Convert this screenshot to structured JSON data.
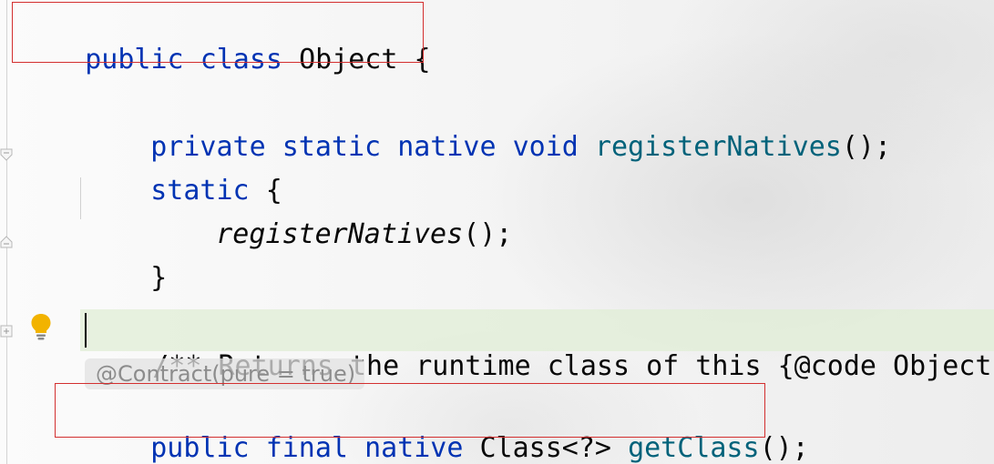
{
  "code": {
    "line_class_decl": {
      "kw1": "public",
      "kw2": "class",
      "name": "Object",
      "brace": "{"
    },
    "line_register": {
      "kw1": "private",
      "kw2": "static",
      "kw3": "native",
      "kw4": "void",
      "fn": "registerNatives",
      "tail": "();"
    },
    "line_static": {
      "kw": "static",
      "brace": "{"
    },
    "line_call": {
      "fn": "registerNatives",
      "tail": "();"
    },
    "line_close": {
      "brace": "}"
    },
    "line_doc": {
      "text": "/** Returns the runtime class of this {@code Object}. Th"
    },
    "annotation": {
      "text": "@Contract(pure = true)"
    },
    "line_getclass": {
      "kw1": "public",
      "kw2": "final",
      "kw3": "native",
      "type": "Class<?>",
      "fn": "getClass",
      "tail": "();"
    }
  },
  "icons": {
    "intention": "lightbulb-icon",
    "fold": "fold-marker-icon"
  },
  "colors": {
    "keyword": "#0033b3",
    "method": "#00627a",
    "text": "#080808",
    "annotation_hint": "#8c8c8c",
    "highlight_border": "#d32f2f",
    "doc_background": "#e0eed6",
    "lightbulb": "#f2b300"
  }
}
